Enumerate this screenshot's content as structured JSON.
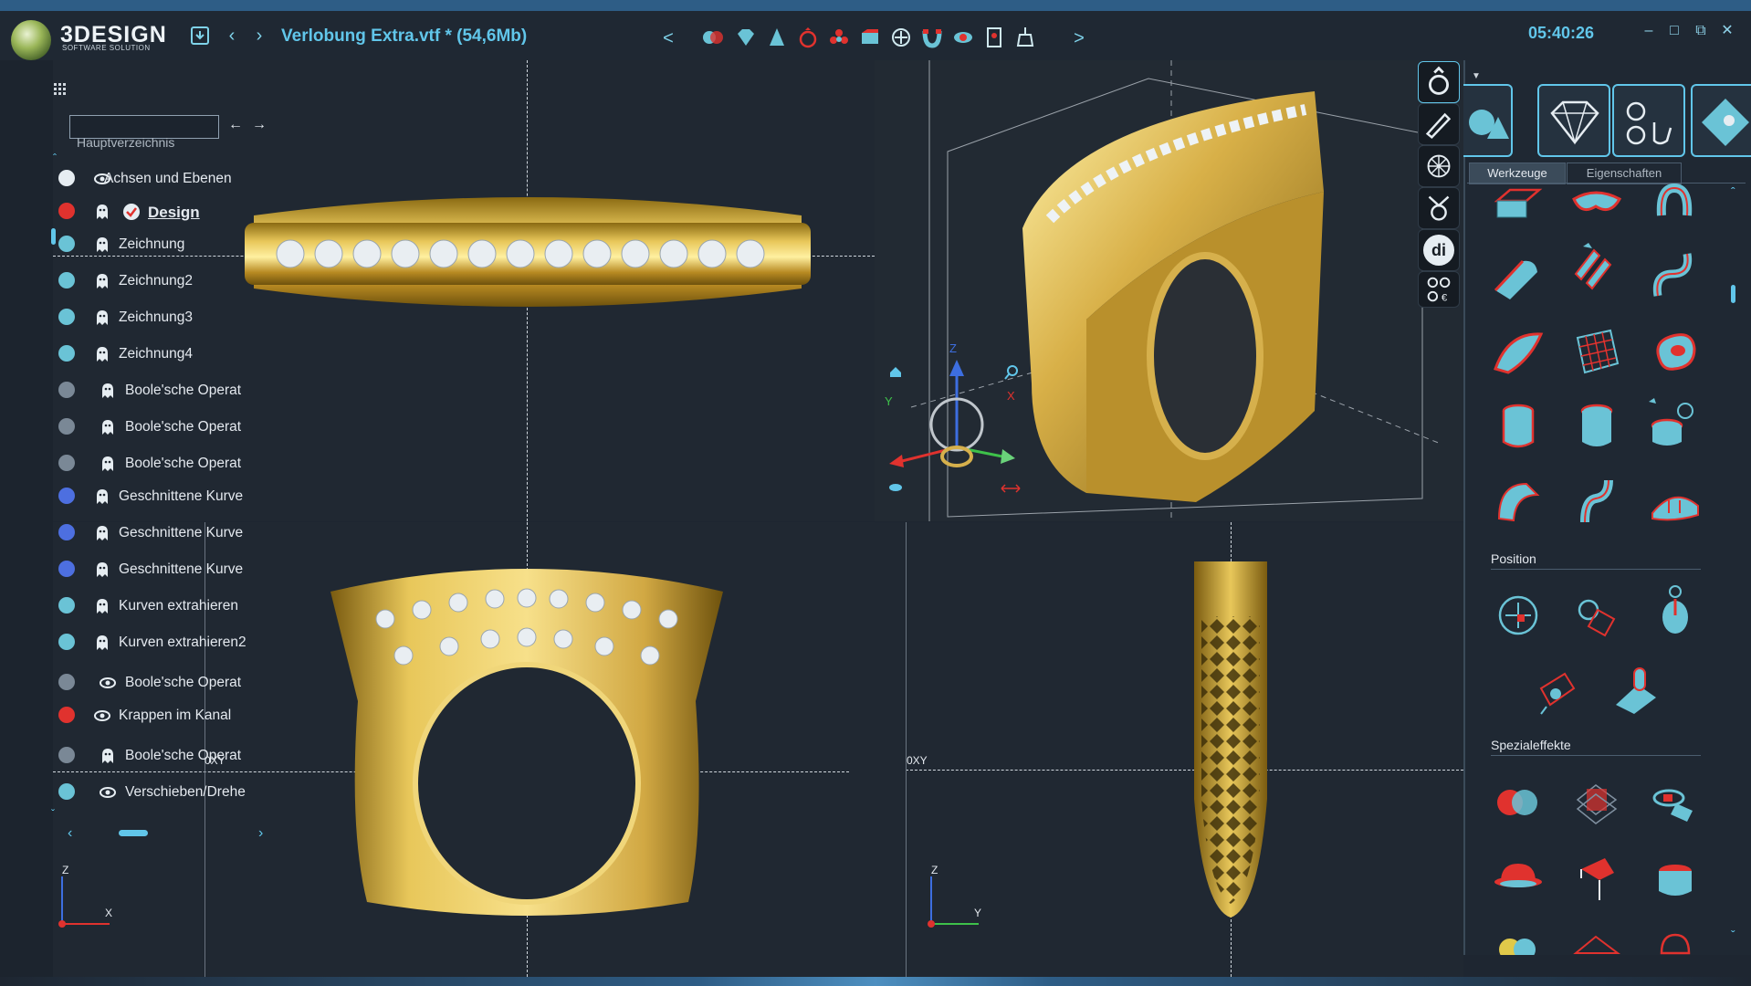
{
  "app": {
    "logo_text": "3DESIGN",
    "logo_subtitle": "SOFTWARE SOLUTION",
    "file_title": "Verlobung Extra.vtf *  (54,6Mb)",
    "clock": "05:40:26"
  },
  "toolbar": {
    "icons": [
      "save-icon",
      "back-arrow-icon",
      "forward-arrow-icon",
      "boolean-icon",
      "gem-icon",
      "prong-icon",
      "ring-icon",
      "cluster-icon",
      "bezel-icon",
      "rotate-icon",
      "magnet-icon",
      "eye-gem-icon",
      "render-icon",
      "pendant-icon"
    ],
    "scroll_left": "<",
    "scroll_right": ">"
  },
  "window_controls": [
    "minimize",
    "maximize",
    "restore",
    "close"
  ],
  "tree": {
    "search_placeholder": "",
    "root_label": "Hauptverzeichnis",
    "items": [
      {
        "label": "Achsen und Ebenen",
        "vis": "eye",
        "bold": false
      },
      {
        "label": "Design",
        "vis": "ghost",
        "bold": true
      },
      {
        "label": "Zeichnung",
        "vis": "ghost",
        "bold": false
      },
      {
        "label": "Zeichnung2",
        "vis": "ghost",
        "bold": false
      },
      {
        "label": "Zeichnung3",
        "vis": "ghost",
        "bold": false
      },
      {
        "label": "Zeichnung4",
        "vis": "ghost",
        "bold": false
      },
      {
        "label": "Boole'sche Operat",
        "vis": "ghost",
        "bold": false
      },
      {
        "label": "Boole'sche Operat",
        "vis": "ghost",
        "bold": false
      },
      {
        "label": "Boole'sche Operat",
        "vis": "ghost",
        "bold": false
      },
      {
        "label": "Geschnittene Kurve",
        "vis": "ghost",
        "bold": false
      },
      {
        "label": "Geschnittene Kurve",
        "vis": "ghost",
        "bold": false
      },
      {
        "label": "Geschnittene Kurve",
        "vis": "ghost",
        "bold": false
      },
      {
        "label": "Kurven extrahieren",
        "vis": "ghost",
        "bold": false
      },
      {
        "label": "Kurven extrahieren2",
        "vis": "ghost",
        "bold": false
      },
      {
        "label": "Boole'sche Operat",
        "vis": "eye",
        "bold": false
      },
      {
        "label": "Krappen im Kanal",
        "vis": "eye",
        "bold": false
      },
      {
        "label": "Boole'sche Operat",
        "vis": "ghost",
        "bold": false
      },
      {
        "label": "Verschieben/Drehe",
        "vis": "eye",
        "bold": false
      }
    ]
  },
  "viewports": {
    "front_label": "0XY",
    "side_label": "0XY",
    "axis_front": {
      "vertical": "Z",
      "horizontal": "X"
    },
    "axis_side": {
      "vertical": "Z",
      "horizontal": "Y"
    },
    "gizmo": {
      "x": "X",
      "y": "Y",
      "z": "Z"
    }
  },
  "right_panel": {
    "tabs": [
      "Werkzeuge",
      "Eigenschaften"
    ],
    "active_tab": "Werkzeuge",
    "sections": {
      "position": "Position",
      "effects": "Spezialeffekte"
    }
  },
  "side_tools": [
    "ring-icon",
    "pencil-icon",
    "mesh-icon",
    "setting-icon",
    "di-icon",
    "price-icon"
  ],
  "side_tool_di": "di",
  "colors": {
    "accent": "#61c6ea",
    "gold": "#c9a23c",
    "tool_red": "#e0322e",
    "tool_teal": "#6ac3d6"
  }
}
